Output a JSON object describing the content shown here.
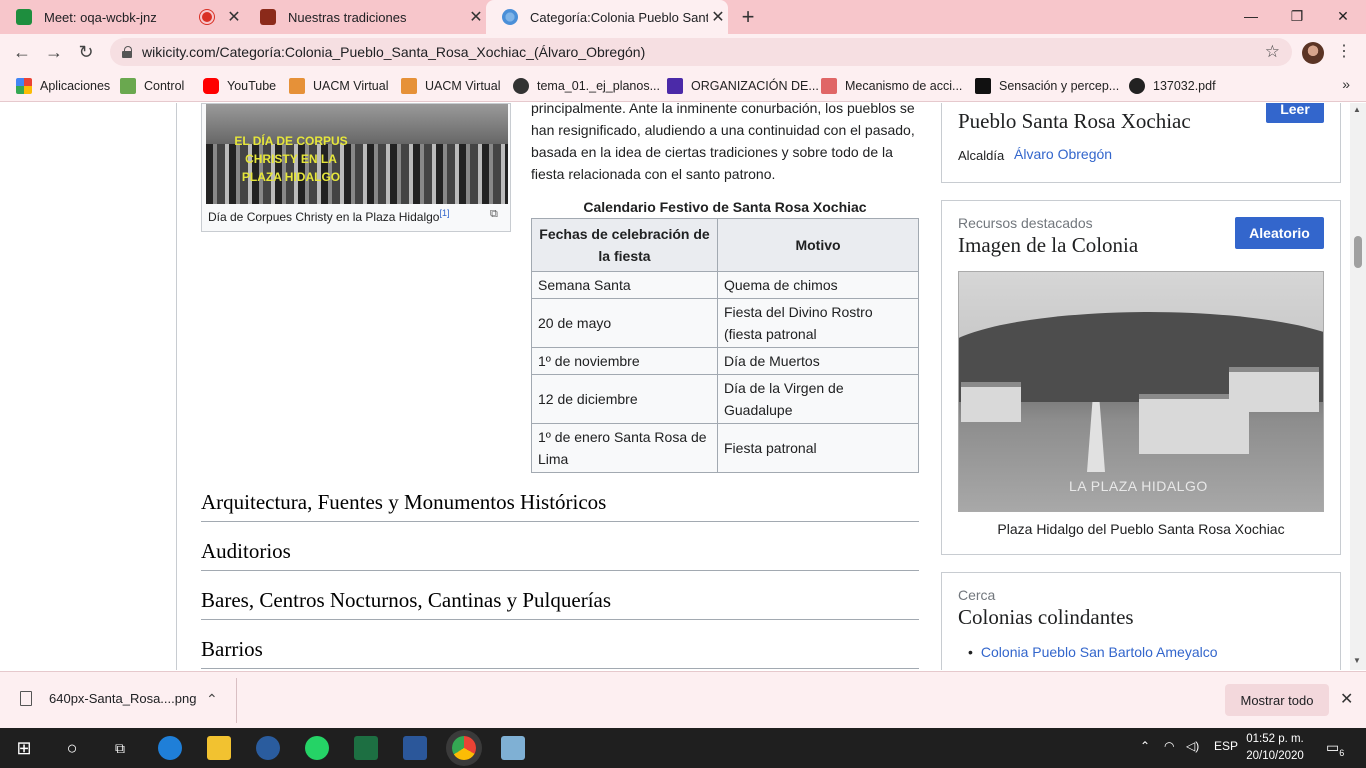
{
  "browser": {
    "tabs": [
      {
        "title": "Meet: oqa-wcbk-jnz",
        "icon_color": "#1e8e3e",
        "recording": true
      },
      {
        "title": "Nuestras tradiciones",
        "icon_color": "#8b2a1a"
      },
      {
        "title": "Categoría:Colonia Pueblo Santa R",
        "icon_color": "#4a8fd8",
        "active": true
      }
    ],
    "new_tab_icon": "plus-icon",
    "url": "wikicity.com/Categoría:Colonia_Pueblo_Santa_Rosa_Xochiac_(Álvaro_Obregón)",
    "bookmarks": [
      {
        "label": "Aplicaciones",
        "icon": "apps-grid-icon",
        "color": "#4285f4"
      },
      {
        "label": "Control",
        "icon": "control-icon",
        "color": "#6aa84f"
      },
      {
        "label": "YouTube",
        "icon": "youtube-icon",
        "color": "#ff0000"
      },
      {
        "label": "UACM Virtual",
        "icon": "uacm-icon",
        "color": "#e69138"
      },
      {
        "label": "UACM Virtual",
        "icon": "uacm-icon",
        "color": "#e69138"
      },
      {
        "label": "tema_01._ej_planos...",
        "icon": "wordpress-icon",
        "color": "#333333"
      },
      {
        "label": "ORGANIZACIÓN DE...",
        "icon": "org-icon",
        "color": "#4b2aa8"
      },
      {
        "label": "Mecanismo de acci...",
        "icon": "mechanism-icon",
        "color": "#e06666"
      },
      {
        "label": "Sensación y percep...",
        "icon": "p-icon",
        "color": "#111111"
      },
      {
        "label": "137032.pdf",
        "icon": "globe-icon",
        "color": "#222222"
      }
    ]
  },
  "article": {
    "figure_overlay_text": "EL DÍA DE CORPUS CHRISTY EN LA PLAZA HIDALGO",
    "figure_caption": "Día de Corpues Christy en la Plaza Hidalgo",
    "figure_ref": "[1]",
    "paragraph": "principalmente. Ante la inminente conurbación, los pueblos se han resignificado, aludiendo a una continuidad con el pasado, basada en la idea de ciertas tradiciones y sobre todo de la fiesta relacionada con el santo patrono.",
    "table_caption": "Calendario Festivo de Santa Rosa Xochiac",
    "table_headers": [
      "Fechas de celebración de la fiesta",
      "Motivo"
    ],
    "table_rows": [
      [
        "Semana Santa",
        "Quema de chimos"
      ],
      [
        "20 de mayo",
        "Fiesta del Divino Rostro (fiesta patronal"
      ],
      [
        "1º de noviembre",
        "Día de Muertos"
      ],
      [
        "12 de diciembre",
        "Día de la Virgen de Guadalupe"
      ],
      [
        "1º de enero Santa Rosa de Lima",
        "Fiesta patronal"
      ]
    ],
    "sections": [
      "Arquitectura, Fuentes y Monumentos Históricos",
      "Auditorios",
      "Bares, Centros Nocturnos, Cantinas y Pulquerías",
      "Barrios"
    ]
  },
  "sidebar": {
    "card1": {
      "title": "Pueblo Santa Rosa Xochiac",
      "button": "Leer",
      "label": "Alcaldía",
      "link": "Álvaro Obregón"
    },
    "card2": {
      "kicker": "Recursos destacados",
      "title": "Imagen de la Colonia",
      "button": "Aleatorio",
      "image_watermark": "LA PLAZA HIDALGO",
      "caption": "Plaza Hidalgo del Pueblo Santa Rosa Xochiac"
    },
    "card3": {
      "kicker": "Cerca",
      "title": "Colonias colindantes",
      "items": [
        "Colonia Pueblo San Bartolo Ameyalco"
      ]
    }
  },
  "downloads": {
    "file": "640px-Santa_Rosa....png",
    "show_all": "Mostrar todo"
  },
  "taskbar": {
    "lang": "ESP",
    "time": "01:52 p. m.",
    "date": "20/10/2020",
    "notifications": "6"
  },
  "colors": {
    "chrome_tabbar": "#f7c6cb",
    "chrome_toolbar": "#fdeff1",
    "link": "#3366cc",
    "button": "#3366cc"
  }
}
